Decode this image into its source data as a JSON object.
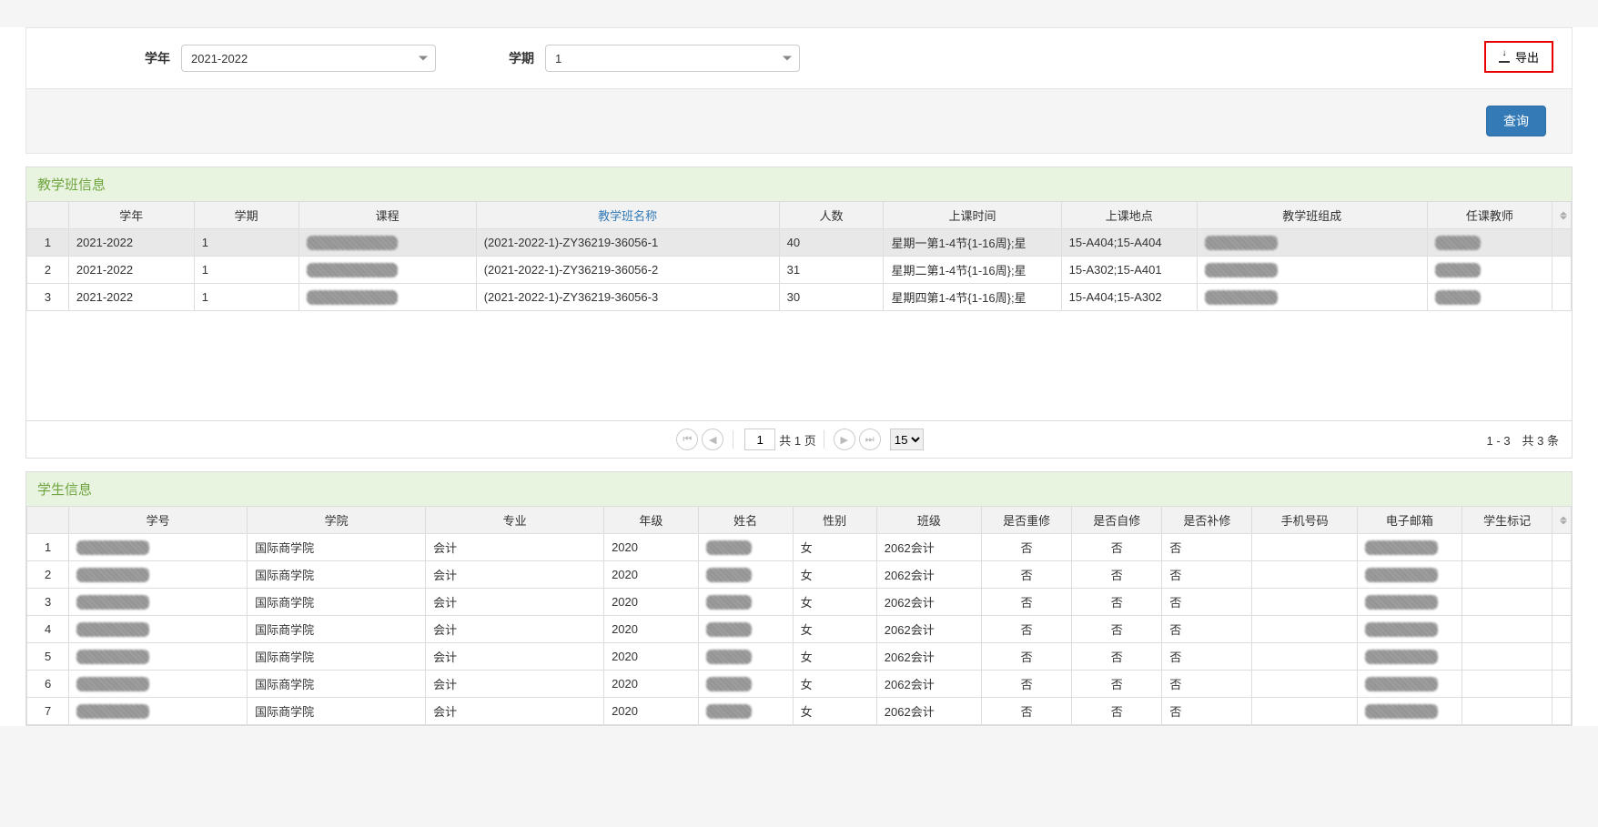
{
  "filters": {
    "year_label": "学年",
    "year_value": "2021-2022",
    "term_label": "学期",
    "term_value": "1"
  },
  "buttons": {
    "export": "导出",
    "query": "查询"
  },
  "class_section": {
    "title": "教学班信息",
    "headers": {
      "year": "学年",
      "term": "学期",
      "course": "课程",
      "class_name": "教学班名称",
      "count": "人数",
      "time": "上课时间",
      "location": "上课地点",
      "composition": "教学班组成",
      "teacher": "任课教师"
    },
    "rows": [
      {
        "n": "1",
        "year": "2021-2022",
        "term": "1",
        "class_name": "(2021-2022-1)-ZY36219-36056-1",
        "count": "40",
        "time": "星期一第1-4节{1-16周};星",
        "location": "15-A404;15-A404"
      },
      {
        "n": "2",
        "year": "2021-2022",
        "term": "1",
        "class_name": "(2021-2022-1)-ZY36219-36056-2",
        "count": "31",
        "time": "星期二第1-4节{1-16周};星",
        "location": "15-A302;15-A401"
      },
      {
        "n": "3",
        "year": "2021-2022",
        "term": "1",
        "class_name": "(2021-2022-1)-ZY36219-36056-3",
        "count": "30",
        "time": "星期四第1-4节{1-16周};星",
        "location": "15-A404;15-A302"
      }
    ]
  },
  "pager": {
    "page": "1",
    "total_pages_text": "共 1 页",
    "page_size": "15",
    "info": "1 - 3　共 3 条"
  },
  "student_section": {
    "title": "学生信息",
    "headers": {
      "id": "学号",
      "college": "学院",
      "major": "专业",
      "grade": "年级",
      "name": "姓名",
      "gender": "性别",
      "class": "班级",
      "retake": "是否重修",
      "selfstudy": "是否自修",
      "makeup": "是否补修",
      "phone": "手机号码",
      "email": "电子邮箱",
      "mark": "学生标记"
    },
    "rows": [
      {
        "n": "1",
        "college": "国际商学院",
        "major": "会计",
        "grade": "2020",
        "gender": "女",
        "class": "2062会计",
        "retake": "否",
        "selfstudy": "否",
        "makeup": "否"
      },
      {
        "n": "2",
        "college": "国际商学院",
        "major": "会计",
        "grade": "2020",
        "gender": "女",
        "class": "2062会计",
        "retake": "否",
        "selfstudy": "否",
        "makeup": "否"
      },
      {
        "n": "3",
        "college": "国际商学院",
        "major": "会计",
        "grade": "2020",
        "gender": "女",
        "class": "2062会计",
        "retake": "否",
        "selfstudy": "否",
        "makeup": "否"
      },
      {
        "n": "4",
        "college": "国际商学院",
        "major": "会计",
        "grade": "2020",
        "gender": "女",
        "class": "2062会计",
        "retake": "否",
        "selfstudy": "否",
        "makeup": "否"
      },
      {
        "n": "5",
        "college": "国际商学院",
        "major": "会计",
        "grade": "2020",
        "gender": "女",
        "class": "2062会计",
        "retake": "否",
        "selfstudy": "否",
        "makeup": "否"
      },
      {
        "n": "6",
        "college": "国际商学院",
        "major": "会计",
        "grade": "2020",
        "gender": "女",
        "class": "2062会计",
        "retake": "否",
        "selfstudy": "否",
        "makeup": "否"
      },
      {
        "n": "7",
        "college": "国际商学院",
        "major": "会计",
        "grade": "2020",
        "gender": "女",
        "class": "2062会计",
        "retake": "否",
        "selfstudy": "否",
        "makeup": "否"
      }
    ]
  }
}
